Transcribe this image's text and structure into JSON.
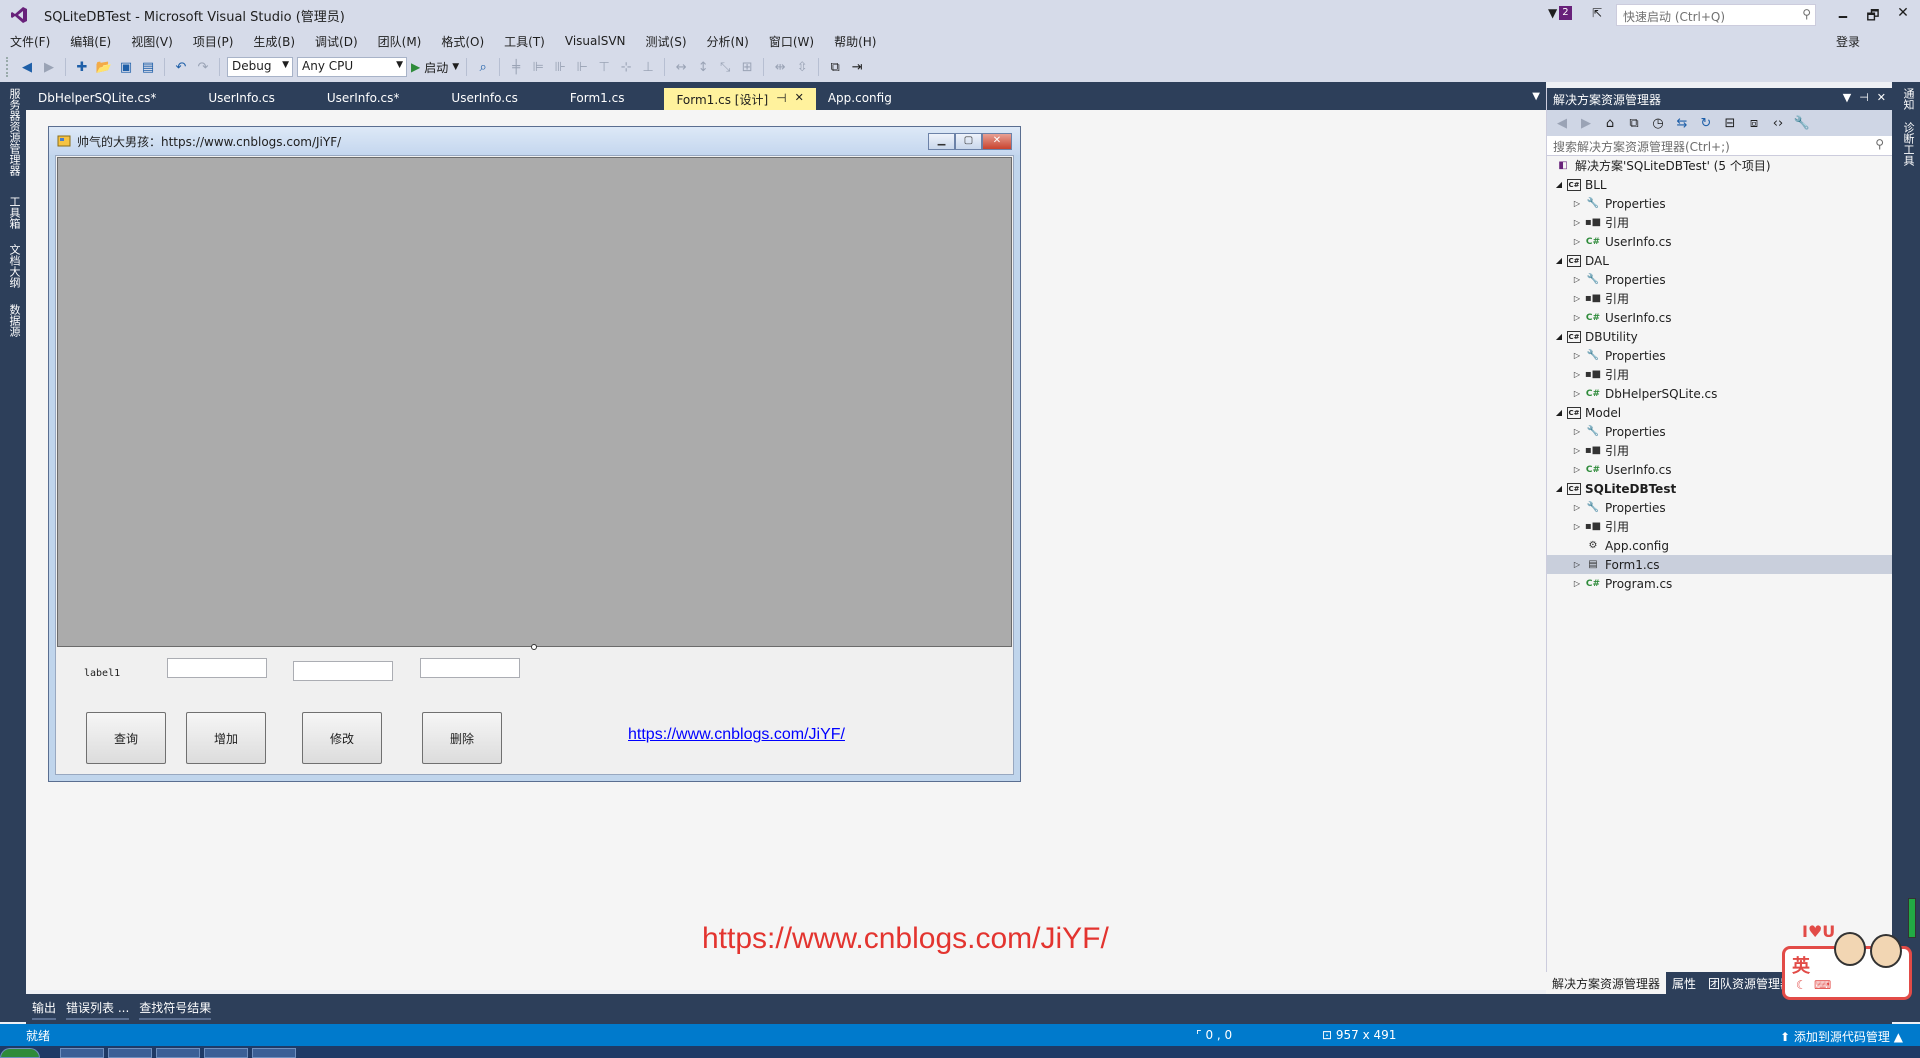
{
  "window": {
    "title": "SQLiteDBTest - Microsoft Visual Studio (管理员)",
    "notification_count": "2",
    "quick_launch_placeholder": "快速启动 (Ctrl+Q)",
    "minimize": "🗕",
    "restore": "🗗",
    "close": "✕"
  },
  "menu": {
    "items": [
      "文件(F)",
      "编辑(E)",
      "视图(V)",
      "项目(P)",
      "生成(B)",
      "调试(D)",
      "团队(M)",
      "格式(O)",
      "工具(T)",
      "VisualSVN",
      "测试(S)",
      "分析(N)",
      "窗口(W)",
      "帮助(H)"
    ],
    "login": "登录"
  },
  "toolbar": {
    "config": "Debug",
    "platform": "Any CPU",
    "start": "启动"
  },
  "left_sidebar": [
    "服务器资源管理器",
    "工具箱",
    "文档大纲",
    "数据源"
  ],
  "right_sidebar": [
    "通知",
    "诊断工具"
  ],
  "tabs": [
    {
      "label": "DbHelperSQLite.cs*"
    },
    {
      "label": "UserInfo.cs"
    },
    {
      "label": "UserInfo.cs*"
    },
    {
      "label": "UserInfo.cs"
    },
    {
      "label": "Form1.cs"
    },
    {
      "label": "Form1.cs [设计]",
      "pin": "⊣",
      "close": "✕"
    },
    {
      "label": "App.config"
    }
  ],
  "form": {
    "title": "帅气的大男孩：https://www.cnblogs.com/JiYF/",
    "label1": "label1",
    "buttons": {
      "query": "查询",
      "add": "增加",
      "edit": "修改",
      "delete": "删除"
    },
    "link": "https://www.cnblogs.com/JiYF/"
  },
  "watermark": "https://www.cnblogs.com/JiYF/",
  "solution_explorer": {
    "title": "解决方案资源管理器",
    "search_placeholder": "搜索解决方案资源管理器(Ctrl+;)",
    "solution": "解决方案'SQLiteDBTest' (5 个项目)",
    "tree": [
      {
        "label": "BLL",
        "level": 1,
        "icon": "project"
      },
      {
        "label": "Properties",
        "level": 2,
        "icon": "wrench"
      },
      {
        "label": "引用",
        "level": 2,
        "icon": "reference"
      },
      {
        "label": "UserInfo.cs",
        "level": 2,
        "icon": "csharp"
      },
      {
        "label": "DAL",
        "level": 1,
        "icon": "project"
      },
      {
        "label": "Properties",
        "level": 2,
        "icon": "wrench"
      },
      {
        "label": "引用",
        "level": 2,
        "icon": "reference"
      },
      {
        "label": "UserInfo.cs",
        "level": 2,
        "icon": "csharp"
      },
      {
        "label": "DBUtility",
        "level": 1,
        "icon": "project"
      },
      {
        "label": "Properties",
        "level": 2,
        "icon": "wrench"
      },
      {
        "label": "引用",
        "level": 2,
        "icon": "reference"
      },
      {
        "label": "DbHelperSQLite.cs",
        "level": 2,
        "icon": "csharp"
      },
      {
        "label": "Model",
        "level": 1,
        "icon": "project"
      },
      {
        "label": "Properties",
        "level": 2,
        "icon": "wrench"
      },
      {
        "label": "引用",
        "level": 2,
        "icon": "reference"
      },
      {
        "label": "UserInfo.cs",
        "level": 2,
        "icon": "csharp"
      },
      {
        "label": "SQLiteDBTest",
        "level": 1,
        "icon": "project"
      },
      {
        "label": "Properties",
        "level": 2,
        "icon": "wrench"
      },
      {
        "label": "引用",
        "level": 2,
        "icon": "reference"
      },
      {
        "label": "App.config",
        "level": 2,
        "icon": "config"
      },
      {
        "label": "Form1.cs",
        "level": 2,
        "icon": "form"
      },
      {
        "label": "Program.cs",
        "level": 2,
        "icon": "csharp"
      }
    ],
    "bottom_tabs": [
      "解决方案资源管理器",
      "属性",
      "团队资源管理器"
    ]
  },
  "bottom_tabs": [
    "输出",
    "错误列表 ...",
    "查找符号结果"
  ],
  "status": {
    "ready": "就绪",
    "position": "0 , 0",
    "size": "957 x 491",
    "source_control": "添加到源代码管理"
  },
  "ime": {
    "mode": "英",
    "love": "I♥U"
  },
  "colors": {
    "accent": "#007acc",
    "chrome": "#d6dbe9",
    "panel_dark": "#2d3f5a",
    "active_tab": "#fff29d",
    "watermark": "#e3342f",
    "vs_purple": "#68217a"
  }
}
